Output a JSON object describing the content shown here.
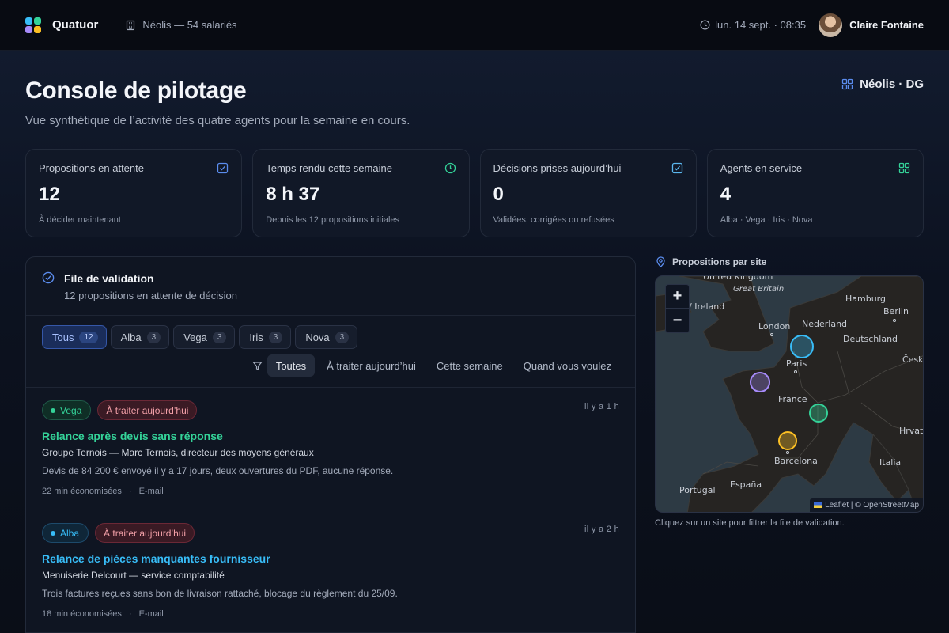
{
  "app": {
    "brand": "Quatuor",
    "organization": "Néolis — 54 salariés",
    "datetime": "lun. 14 sept. · 08:35",
    "user": "Claire Fontaine"
  },
  "page": {
    "title": "Console de pilotage",
    "subtitle": "Vue synthétique de l’activité des quatre agents pour la semaine en cours.",
    "role": "Néolis · DG"
  },
  "stats": [
    {
      "label": "Propositions en attente",
      "value": "12",
      "note": "À décider maintenant",
      "icon": "check-square-icon",
      "color": "#5b8def"
    },
    {
      "label": "Temps rendu cette semaine",
      "value": "8 h 37",
      "note": "Depuis les 12 propositions initiales",
      "icon": "clock-icon",
      "color": "#34d399"
    },
    {
      "label": "Décisions prises aujourd’hui",
      "value": "0",
      "note": "Validées, corrigées ou refusées",
      "icon": "check-square-icon",
      "color": "#5bb7ef"
    },
    {
      "label": "Agents en service",
      "value": "4",
      "note": "Alba · Vega · Iris · Nova",
      "icon": "grid-icon",
      "color": "#34d399"
    }
  ],
  "queue": {
    "title": "File de validation",
    "subtitle": "12 propositions en attente de décision",
    "agent_filters": [
      {
        "label": "Tous",
        "count": "12"
      },
      {
        "label": "Alba",
        "count": "3"
      },
      {
        "label": "Vega",
        "count": "3"
      },
      {
        "label": "Iris",
        "count": "3"
      },
      {
        "label": "Nova",
        "count": "3"
      }
    ],
    "time_filters": [
      "Toutes",
      "À traiter aujourd’hui",
      "Cette semaine",
      "Quand vous voulez"
    ],
    "items": [
      {
        "agent": "Vega",
        "agent_color": "#34d399",
        "urgency": "À traiter aujourd’hui",
        "ago": "il y a 1 h",
        "title": "Relance après devis sans réponse",
        "client": "Groupe Ternois — Marc Ternois, directeur des moyens généraux",
        "description": "Devis de 84 200 € envoyé il y a 17 jours, deux ouvertures du PDF, aucune réponse.",
        "saved": "22 min économisées",
        "channel": "E-mail"
      },
      {
        "agent": "Alba",
        "agent_color": "#38bdf8",
        "urgency": "À traiter aujourd’hui",
        "ago": "il y a 2 h",
        "title": "Relance de pièces manquantes fournisseur",
        "client": "Menuiserie Delcourt — service comptabilité",
        "description": "Trois factures reçues sans bon de livraison rattaché, blocage du règlement du 25/09.",
        "saved": "18 min économisées",
        "channel": "E-mail"
      }
    ]
  },
  "map": {
    "label": "Propositions par site",
    "zoom_in": "+",
    "zoom_out": "−",
    "attribution": "Leaflet | © OpenStreetMap",
    "help": "Cliquez sur un site pour filtrer la file de validation.",
    "places": {
      "united_kingdom": "United Kingdom",
      "great_britain": "Great Britain",
      "ireland": "/ Ireland",
      "london": "London",
      "nederland": "Nederland",
      "hamburg": "Hamburg",
      "berlin": "Berlin",
      "deutschland": "Deutschland",
      "cesk": "Česk",
      "paris": "Paris",
      "france": "France",
      "hrvatsk": "Hrvatsk",
      "barcelona": "Barcelona",
      "italia": "Italia",
      "espana": "España",
      "portugal": "Portugal"
    },
    "site_colors": [
      "#38bdf8",
      "#a78bfa",
      "#34d399",
      "#fbbf24"
    ]
  }
}
